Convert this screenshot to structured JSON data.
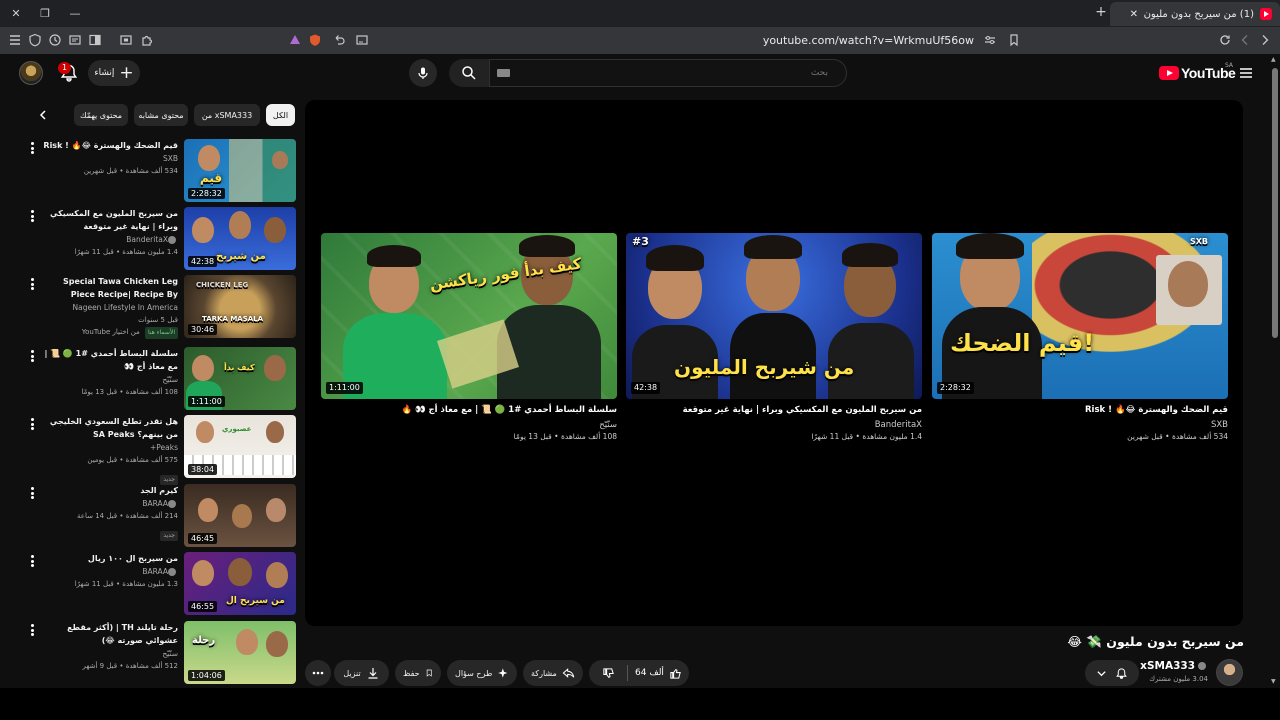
{
  "browser": {
    "tab_title": "(1) من سيربح بدون مليون 💸",
    "url": "youtube.com/watch?v=WrkmuUf56ow",
    "new_tab": "+",
    "close_tab": "✕"
  },
  "header": {
    "logo_text": "YouTube",
    "region": "SA",
    "search_placeholder": "بحث",
    "create_label": "إنشاء",
    "notification_count": "1"
  },
  "chips": [
    {
      "label": "الكل",
      "active": true
    },
    {
      "label": "من xSMA333",
      "active": false
    },
    {
      "label": "محتوى مشابه",
      "active": false
    },
    {
      "label": "محتوى يهمّك",
      "active": false
    }
  ],
  "sidebar": {
    "items": [
      {
        "title": "قيم الضحك والهسترة 😂🔥 ! Risk",
        "channel": "SXB",
        "meta": "534 ألف مشاهدة • قبل شهرين",
        "duration": "2:28:32",
        "badge": ""
      },
      {
        "title": "من سيربح المليون مع المكسيكي وبراء | نهاية غير متوقعة",
        "channel": "BanderitaX",
        "meta": "1.4 مليون مشاهدة • قبل 11 شهرًا",
        "duration": "42:38",
        "badge": ""
      },
      {
        "title": "Special Tawa Chicken Leg Piece Recipe| Recipe By Tarka...",
        "channel": "Nageen Lifestyle In America",
        "meta": "قبل 5 سنوات",
        "duration": "30:46",
        "badge": "الأسماء هنا",
        "extra": "من اختيار YouTube"
      },
      {
        "title": "سلسلة البساط أحمدي #1 🟢 📜 | مع معاذ أج 👀",
        "channel": "سنّيّح",
        "meta": "108 ألف مشاهدة • قبل 13 يومًا",
        "duration": "1:11:00",
        "badge": ""
      },
      {
        "title": "هل تقدر تطلع السعودي الخليجي من بينهم؟ SA Peaks",
        "channel": "Peaks+",
        "meta": "575 ألف مشاهدة • قبل يومين",
        "duration": "38:04",
        "badge": "جديد"
      },
      {
        "title": "كيرم الجد",
        "channel": "BARAA",
        "meta": "214 ألف مشاهدة • قبل 14 ساعة",
        "duration": "46:45",
        "badge": "جديد"
      },
      {
        "title": "من سيربح ال ١٠٠ ريال",
        "channel": "BARAA",
        "meta": "1.3 مليون مشاهدة • قبل 11 شهرًا",
        "duration": "46:55",
        "badge": ""
      },
      {
        "title": "رحلة تايلند TH | (أكثر مقطع عشوائي صورته 😂)",
        "channel": "سنّيّح",
        "meta": "512 ألف مشاهدة • قبل 9 أشهر",
        "duration": "1:04:06",
        "badge": ""
      }
    ]
  },
  "end_screen": {
    "cards": [
      {
        "title": "قيم الضحك والهسترة 😂🔥 ! Risk",
        "channel": "SXB",
        "meta": "534 ألف مشاهدة • قبل شهرين",
        "duration": "2:28:32",
        "thumb_text": "قيم الضحك!",
        "thumb_tag": "SXB"
      },
      {
        "title": "من سيربح المليون مع المكسيكي وبراء | نهاية غير متوقعة",
        "channel": "BanderitaX",
        "meta": "1.4 مليون مشاهدة • قبل 11 شهرًا",
        "duration": "42:38",
        "thumb_text": "من شيربح المليون",
        "thumb_tag": "#3"
      },
      {
        "title": "سلسلة البساط أحمدي #1 🟢 📜 | مع معاذ أج 👀 🔥",
        "channel": "سنّيّح",
        "meta": "108 ألف مشاهدة • قبل 13 يومًا",
        "duration": "1:11:00",
        "thumb_text": "كيف بدأ فور رياكشن",
        "thumb_tag": ""
      }
    ]
  },
  "video": {
    "title": "من سيربح بدون مليون 💸 😂",
    "channel": "xSMA333",
    "subscribers": "3.04 مليون مشترك",
    "likes": "64 ألف",
    "share_label": "مشاركة",
    "ask_label": "طرح سؤال",
    "save_label": "حفظ",
    "download_label": "تنزيل"
  },
  "colors": {
    "background": "#0f0f0f",
    "chip": "#272727",
    "accent_red": "#ff0033",
    "text_secondary": "#aaaaaa"
  }
}
